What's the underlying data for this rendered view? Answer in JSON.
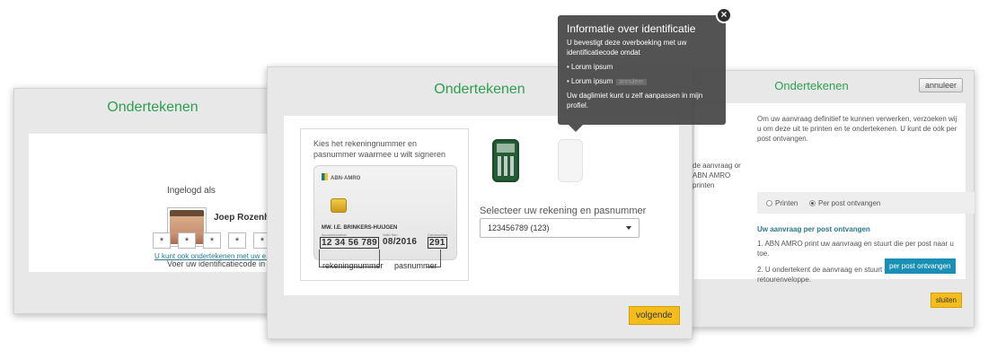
{
  "left": {
    "title": "Ondertekenen",
    "logged_in_label": "Ingelogd als",
    "user_name": "Joep Rozenhart",
    "code_label": "Voer uw identificatiecode in",
    "pin_chars": [
      "*",
      "*",
      "*",
      "*",
      "*"
    ],
    "link_text": "U kunt ook ondertekenen met uw e.de"
  },
  "middle": {
    "title": "Ondertekenen",
    "instruction": "Kies het rekeningnummer en pasnummer waarmee u wilt signeren",
    "card": {
      "bank": "ABN·AMRO",
      "holder": "MW. I.E. BRINKERS-HUIJGEN",
      "account_caption": "Accountnumber",
      "valid_caption": "Valid thru",
      "card_caption": "Cardnumber",
      "account_number": "12 34 56 789",
      "valid_thru": "08/2016",
      "card_number": "291"
    },
    "account_label": "rekeningnummer",
    "card_label": "pasnummer",
    "select_label": "Selecteer uw rekening en pasnummer",
    "select_value": "123456789 (123)",
    "next_button": "volgende"
  },
  "right": {
    "title": "Ondertekenen",
    "cancel_button": "annuleer",
    "intro": "Om uw aanvraag definitief te kunnen verwerken, verzoeken wij u om deze uit te printen en te ondertekenen. U kunt de ook per post ontvangen.",
    "side_text": "de aanvraag or ABN AMRO printen",
    "option_print": "Printen",
    "option_post": "Per post ontvangen",
    "subheading": "Uw aanvraag per post ontvangen",
    "step1": "1. ABN AMRO print uw aanvraag en stuurt die per post naar u toe.",
    "step2": "2. U ondertekent de aanvraag en stuurt deze retour in de retourenveloppe.",
    "post_button": "per post ontvangen",
    "close_button": "sluiten"
  },
  "tooltip": {
    "title": "Informatie over identificatie",
    "body": "U bevestigt deze overboeking met uw identificatiecode omdat",
    "item1": "• Lorum ipsum",
    "item2": "• Lorum ipsum",
    "ghost": "annuleer",
    "footer": "Uw daglimiet kunt u zelf aanpassen in mijn profiel."
  },
  "colors": {
    "title_green": "#2f9e52",
    "button_yellow": "#f4bd1e",
    "button_blue": "#1a8fb5",
    "link_teal": "#2a7a8c"
  }
}
